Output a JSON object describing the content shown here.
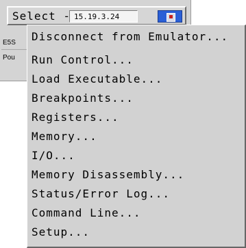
{
  "toolbar": {
    "select_label": "Select ->",
    "address": "15.19.3.24",
    "status_icon": "emulator-status-icon"
  },
  "background_rows": {
    "row1_text": "E5S",
    "row2_text": "Pou"
  },
  "menu": {
    "items": [
      {
        "label": "Disconnect from Emulator..."
      },
      {
        "label": "Run Control..."
      },
      {
        "label": "Load Executable..."
      },
      {
        "label": "Breakpoints..."
      },
      {
        "label": "Registers..."
      },
      {
        "label": "Memory..."
      },
      {
        "label": "I/O..."
      },
      {
        "label": "Memory Disassembly..."
      },
      {
        "label": "Status/Error Log..."
      },
      {
        "label": "Command Line..."
      },
      {
        "label": "Setup..."
      }
    ]
  },
  "colors": {
    "window_bg": "#d4d4d4",
    "menu_bg": "#d2d2d2",
    "status_icon_blue": "#2a5fd6",
    "status_icon_red": "#c62020"
  }
}
